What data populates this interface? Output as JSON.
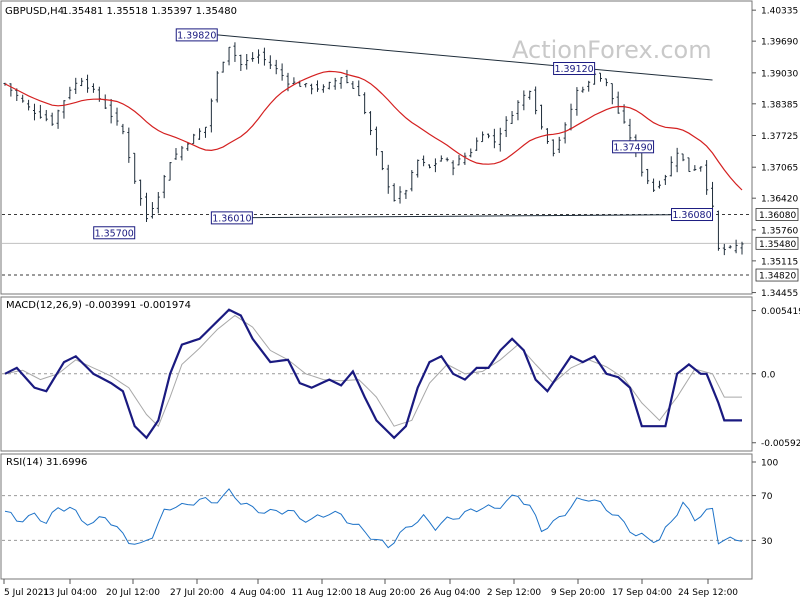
{
  "header": {
    "symbol": "GBPUSD,H4",
    "ohlc": "1.35481 1.35518 1.35397 1.35480"
  },
  "watermark": "ActionForex.com",
  "colors": {
    "candle": "#1f2d3a",
    "ma": "#d42020",
    "trendline": "#1f2d3a",
    "dashed": "#3a3a3a",
    "macd": "#1a1a80",
    "signal": "#a9a9a9",
    "rsi": "#1e73c8",
    "label_border": "#1a1a80",
    "watermark": "#c9c9c9"
  },
  "chart_data": [
    {
      "type": "candlestick",
      "panel": "price",
      "ylim": [
        1.3455,
        1.4038
      ],
      "y_ticks": [
        "1.40335",
        "1.39690",
        "1.39030",
        "1.38385",
        "1.37725",
        "1.37065",
        "1.36420",
        "1.35760",
        "1.35115",
        "1.34455"
      ],
      "x_ticks": [
        "5 Jul 2021",
        "13 Jul 04:00",
        "20 Jul 12:00",
        "27 Jul 20:00",
        "4 Aug 04:00",
        "11 Aug 12:00",
        "18 Aug 20:00",
        "26 Aug 04:00",
        "2 Sep 12:00",
        "9 Sep 20:00",
        "17 Sep 04:00",
        "24 Sep 12:00"
      ],
      "bar_count": 126,
      "close_anchors": [
        [
          0,
          1.388
        ],
        [
          4,
          1.383
        ],
        [
          8,
          1.38
        ],
        [
          11,
          1.387
        ],
        [
          13,
          1.389
        ],
        [
          16,
          1.385
        ],
        [
          20,
          1.378
        ],
        [
          22,
          1.368
        ],
        [
          24,
          1.36
        ],
        [
          26,
          1.365
        ],
        [
          28,
          1.372
        ],
        [
          31,
          1.376
        ],
        [
          34,
          1.379
        ],
        [
          36,
          1.39
        ],
        [
          38,
          1.396
        ],
        [
          40,
          1.392
        ],
        [
          43,
          1.394
        ],
        [
          46,
          1.391
        ],
        [
          48,
          1.3885
        ],
        [
          51,
          1.3875
        ],
        [
          54,
          1.387
        ],
        [
          57,
          1.3895
        ],
        [
          60,
          1.386
        ],
        [
          62,
          1.378
        ],
        [
          64,
          1.37
        ],
        [
          66,
          1.364
        ],
        [
          68,
          1.366
        ],
        [
          70,
          1.372
        ],
        [
          72,
          1.3705
        ],
        [
          74,
          1.3725
        ],
        [
          76,
          1.371
        ],
        [
          79,
          1.374
        ],
        [
          81,
          1.378
        ],
        [
          83,
          1.376
        ],
        [
          85,
          1.38
        ],
        [
          87,
          1.384
        ],
        [
          89,
          1.387
        ],
        [
          91,
          1.379
        ],
        [
          93,
          1.374
        ],
        [
          95,
          1.379
        ],
        [
          97,
          1.3865
        ],
        [
          99,
          1.388
        ],
        [
          100,
          1.3905
        ],
        [
          102,
          1.388
        ],
        [
          104,
          1.382
        ],
        [
          106,
          1.377
        ],
        [
          108,
          1.37
        ],
        [
          110,
          1.366
        ],
        [
          112,
          1.369
        ],
        [
          114,
          1.374
        ],
        [
          116,
          1.37
        ],
        [
          118,
          1.371
        ],
        [
          120,
          1.362
        ],
        [
          121,
          1.3535
        ],
        [
          123,
          1.3535
        ],
        [
          125,
          1.3548
        ]
      ],
      "ma_period": 20,
      "level_labels": [
        "1.36080",
        "1.35480",
        "1.34820"
      ],
      "dashed_levels": [
        1.3608,
        1.3482
      ],
      "current_price": 1.3548,
      "annotations": [
        "1.39820",
        "1.39120",
        "1.37490",
        "1.36010",
        "1.36080",
        "1.35700"
      ],
      "trendlines": [
        {
          "from": [
            36,
            1.3982
          ],
          "to": [
            120,
            1.3888
          ]
        },
        {
          "from": [
            35,
            1.3601
          ],
          "to": [
            120,
            1.3608
          ]
        }
      ]
    },
    {
      "type": "line",
      "panel": "macd",
      "title": "MACD(12,26,9) -0.003991 -0.001974",
      "y_ticks": [
        "0.005419",
        "0.0",
        "-0.005921"
      ],
      "ylim": [
        -0.0062,
        0.0059
      ],
      "series": [
        {
          "name": "MACD",
          "anchors": [
            [
              0,
              0.0
            ],
            [
              2,
              0.0005
            ],
            [
              5,
              -0.0012
            ],
            [
              7,
              -0.0015
            ],
            [
              10,
              0.001
            ],
            [
              12,
              0.0015
            ],
            [
              15,
              0.0
            ],
            [
              18,
              -0.0008
            ],
            [
              20,
              -0.0015
            ],
            [
              22,
              -0.0045
            ],
            [
              24,
              -0.0055
            ],
            [
              26,
              -0.004
            ],
            [
              28,
              0.0
            ],
            [
              30,
              0.0025
            ],
            [
              33,
              0.003
            ],
            [
              36,
              0.0045
            ],
            [
              38,
              0.0055
            ],
            [
              40,
              0.005
            ],
            [
              42,
              0.003
            ],
            [
              45,
              0.001
            ],
            [
              48,
              0.0012
            ],
            [
              50,
              -0.0008
            ],
            [
              52,
              -0.0012
            ],
            [
              55,
              -0.0005
            ],
            [
              57,
              -0.001
            ],
            [
              59,
              0.0002
            ],
            [
              61,
              -0.002
            ],
            [
              63,
              -0.004
            ],
            [
              66,
              -0.0055
            ],
            [
              68,
              -0.0045
            ],
            [
              70,
              -0.0012
            ],
            [
              72,
              0.001
            ],
            [
              74,
              0.0015
            ],
            [
              76,
              0.0
            ],
            [
              78,
              -0.0005
            ],
            [
              80,
              0.0005
            ],
            [
              82,
              0.0005
            ],
            [
              84,
              0.002
            ],
            [
              86,
              0.003
            ],
            [
              88,
              0.002
            ],
            [
              90,
              -0.0005
            ],
            [
              92,
              -0.0015
            ],
            [
              94,
              0.0
            ],
            [
              96,
              0.0015
            ],
            [
              98,
              0.001
            ],
            [
              100,
              0.0015
            ],
            [
              102,
              0.0
            ],
            [
              104,
              -0.0003
            ],
            [
              106,
              -0.0012
            ],
            [
              108,
              -0.0045
            ],
            [
              110,
              -0.0045
            ],
            [
              112,
              -0.0045
            ],
            [
              114,
              0.0
            ],
            [
              116,
              0.0008
            ],
            [
              118,
              -0.0
            ],
            [
              119,
              0.0
            ],
            [
              121,
              -0.0025
            ],
            [
              122,
              -0.004
            ]
          ]
        },
        {
          "name": "Signal",
          "anchors": [
            [
              0,
              0.0
            ],
            [
              3,
              0.0003
            ],
            [
              6,
              -0.0005
            ],
            [
              9,
              0.0
            ],
            [
              12,
              0.0012
            ],
            [
              15,
              0.0005
            ],
            [
              18,
              -0.0002
            ],
            [
              21,
              -0.0012
            ],
            [
              24,
              -0.0035
            ],
            [
              26,
              -0.0045
            ],
            [
              28,
              -0.002
            ],
            [
              30,
              0.0008
            ],
            [
              33,
              0.0022
            ],
            [
              36,
              0.0038
            ],
            [
              39,
              0.005
            ],
            [
              42,
              0.004
            ],
            [
              45,
              0.002
            ],
            [
              48,
              0.0012
            ],
            [
              51,
              0.0
            ],
            [
              54,
              -0.0005
            ],
            [
              57,
              -0.0006
            ],
            [
              60,
              -0.0005
            ],
            [
              63,
              -0.002
            ],
            [
              66,
              -0.0045
            ],
            [
              69,
              -0.004
            ],
            [
              72,
              -0.0008
            ],
            [
              75,
              0.0008
            ],
            [
              78,
              0.0
            ],
            [
              81,
              0.0002
            ],
            [
              84,
              0.0012
            ],
            [
              87,
              0.0025
            ],
            [
              90,
              0.0008
            ],
            [
              93,
              -0.0008
            ],
            [
              96,
              0.0005
            ],
            [
              99,
              0.0012
            ],
            [
              102,
              0.0006
            ],
            [
              105,
              -0.0004
            ],
            [
              108,
              -0.0025
            ],
            [
              111,
              -0.004
            ],
            [
              114,
              -0.002
            ],
            [
              117,
              0.0004
            ],
            [
              120,
              0.0
            ],
            [
              122,
              -0.002
            ]
          ]
        }
      ]
    },
    {
      "type": "line",
      "panel": "rsi",
      "title": "RSI(14) 31.6996",
      "y_ticks": [
        "100",
        "70",
        "30",
        "0"
      ],
      "ylim": [
        0,
        100
      ],
      "levels": [
        70,
        30
      ],
      "series": [
        {
          "name": "RSI",
          "anchors": [
            [
              0,
              56
            ],
            [
              2,
              48
            ],
            [
              5,
              52
            ],
            [
              7,
              47
            ],
            [
              9,
              58
            ],
            [
              11,
              60
            ],
            [
              13,
              48
            ],
            [
              15,
              45
            ],
            [
              17,
              52
            ],
            [
              19,
              40
            ],
            [
              21,
              30
            ],
            [
              23,
              25
            ],
            [
              25,
              35
            ],
            [
              27,
              55
            ],
            [
              29,
              62
            ],
            [
              31,
              60
            ],
            [
              33,
              68
            ],
            [
              35,
              63
            ],
            [
              37,
              70
            ],
            [
              38,
              73
            ],
            [
              40,
              65
            ],
            [
              42,
              58
            ],
            [
              45,
              55
            ],
            [
              48,
              57
            ],
            [
              50,
              50
            ],
            [
              52,
              48
            ],
            [
              55,
              55
            ],
            [
              57,
              52
            ],
            [
              59,
              45
            ],
            [
              61,
              38
            ],
            [
              63,
              30
            ],
            [
              65,
              25
            ],
            [
              67,
              35
            ],
            [
              69,
              45
            ],
            [
              71,
              50
            ],
            [
              73,
              42
            ],
            [
              75,
              48
            ],
            [
              77,
              52
            ],
            [
              79,
              56
            ],
            [
              81,
              60
            ],
            [
              83,
              58
            ],
            [
              85,
              65
            ],
            [
              87,
              70
            ],
            [
              89,
              60
            ],
            [
              91,
              40
            ],
            [
              93,
              45
            ],
            [
              95,
              55
            ],
            [
              97,
              65
            ],
            [
              99,
              68
            ],
            [
              101,
              62
            ],
            [
              103,
              55
            ],
            [
              105,
              45
            ],
            [
              107,
              35
            ],
            [
              109,
              32
            ],
            [
              111,
              30
            ],
            [
              113,
              48
            ],
            [
              115,
              62
            ],
            [
              117,
              50
            ],
            [
              119,
              55
            ],
            [
              120,
              58
            ],
            [
              121,
              30
            ],
            [
              123,
              30
            ],
            [
              125,
              32
            ]
          ]
        }
      ]
    }
  ]
}
